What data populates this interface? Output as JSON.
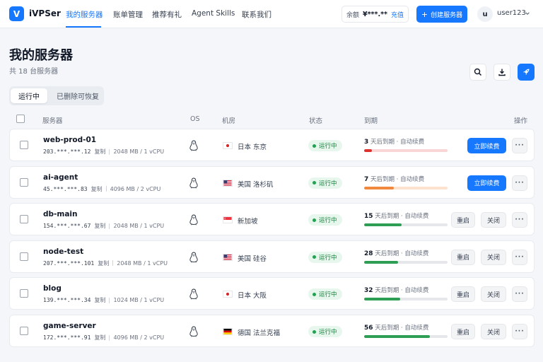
{
  "nav": {
    "logo_letter": "V",
    "brand": "iVPSer",
    "items": [
      "我的服务器",
      "账单管理",
      "推荐有礼",
      "Agent Skills",
      "联系我们"
    ],
    "balance_label": "余额",
    "balance_value": "¥***.**",
    "topup": "充值",
    "create_button": "创建服务器",
    "avatar_letter": "u",
    "username": "user123"
  },
  "header": {
    "title": "我的服务器",
    "subtitle": "共 18 台服务器"
  },
  "tabs": [
    "运行中",
    "已删除可恢复"
  ],
  "columns": [
    "服务器",
    "OS",
    "机房",
    "状态",
    "到期",
    "操作"
  ],
  "copy_label": "复制",
  "status_label": "运行中",
  "expire_suffix": "天后到期 · 自动续费",
  "actions": {
    "renew": "立即续费",
    "reboot": "重启",
    "shutdown": "关闭",
    "more": "···"
  },
  "servers": [
    {
      "name": "web-prod-01",
      "ip": "203.***.***.12",
      "spec": "2048 MB / 1 vCPU",
      "region": "日本 东京",
      "flag": "jp",
      "days": "3",
      "progress": 0.09,
      "bar_color": "#e03131",
      "track": "#f9d5d5",
      "renew": true
    },
    {
      "name": "ai-agent",
      "ip": "45.***.***.83",
      "spec": "4096 MB / 2 vCPU",
      "region": "美国 洛杉矶",
      "flag": "us",
      "days": "7",
      "progress": 0.36,
      "bar_color": "#f0883e",
      "track": "#fde3cf",
      "renew": true
    },
    {
      "name": "db-main",
      "ip": "154.***.***.67",
      "spec": "2048 MB / 1 vCPU",
      "region": "新加坡",
      "flag": "sg",
      "days": "15",
      "progress": 0.45,
      "bar_color": "#2f9e55",
      "track": "#e5e7eb",
      "renew": false
    },
    {
      "name": "node-test",
      "ip": "207.***.***.101",
      "spec": "2048 MB / 1 vCPU",
      "region": "美国 硅谷",
      "flag": "us",
      "days": "28",
      "progress": 0.41,
      "bar_color": "#2f9e55",
      "track": "#e5e7eb",
      "renew": false
    },
    {
      "name": "blog",
      "ip": "139.***.***.34",
      "spec": "1024 MB / 1 vCPU",
      "region": "日本 大阪",
      "flag": "jp",
      "days": "32",
      "progress": 0.43,
      "bar_color": "#2f9e55",
      "track": "#e5e7eb",
      "renew": false
    },
    {
      "name": "game-server",
      "ip": "172.***.***.91",
      "spec": "4096 MB / 2 vCPU",
      "region": "德国 法兰克福",
      "flag": "de",
      "days": "56",
      "progress": 0.79,
      "bar_color": "#2f9e55",
      "track": "#e5e7eb",
      "renew": false
    }
  ],
  "colors": {
    "accent": "#1677ff",
    "status_green": "#22a150"
  },
  "icons": {
    "search": "search-icon",
    "download": "download-icon",
    "deploy": "rocket-icon",
    "os": "linux-penguin-icon"
  }
}
